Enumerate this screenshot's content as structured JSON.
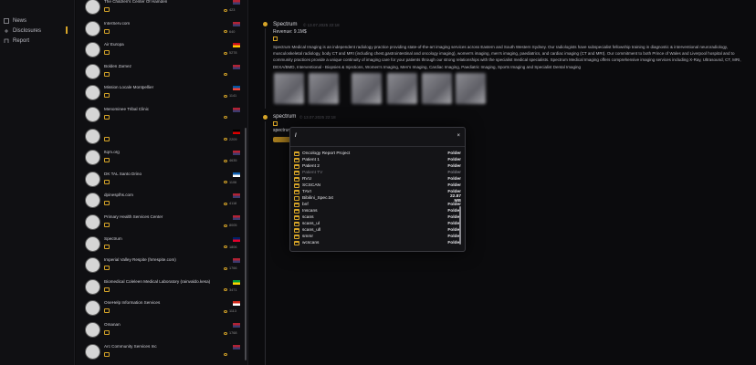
{
  "nav": {
    "items": [
      {
        "label": "News",
        "icon": "news-icon"
      },
      {
        "label": "Disclosures",
        "icon": "disclosures-icon"
      },
      {
        "label": "Report",
        "icon": "report-icon"
      }
    ]
  },
  "list": {
    "items": [
      {
        "name": "The Children's Center Of Hamden",
        "views": "423",
        "flag": "us"
      },
      {
        "name": "InterServ.com",
        "views": "640",
        "flag": "us"
      },
      {
        "name": "Air Europa",
        "views": "5278",
        "flag": "es"
      },
      {
        "name": "Bolden Zarnez",
        "views": "",
        "flag": "us"
      },
      {
        "name": "Mission Locale Montpellier",
        "views": "1141",
        "flag": "fr"
      },
      {
        "name": "Menominee Tribal Clinic",
        "views": "",
        "flag": "us"
      },
      {
        "name": "",
        "views": "2209",
        "flag": "de"
      },
      {
        "name": "Itqm.org",
        "views": "4635",
        "flag": "us"
      },
      {
        "name": "DK TAL Santo Drino",
        "views": "1106",
        "flag": "gr"
      },
      {
        "name": "dpinesplhs.com",
        "views": "4118",
        "flag": "us"
      },
      {
        "name": "Primary Health Services Center",
        "views": "8005",
        "flag": "us"
      },
      {
        "name": "Spectrum",
        "views": "1806",
        "flag": "au"
      },
      {
        "name": "Imperial Valley Respite (hrrespite.com)",
        "views": "1766",
        "flag": "us"
      },
      {
        "name": "Biomedical Coleleen Medical Laboratory (rainvaldo.kesa)",
        "views": "3471",
        "flag": "jm"
      },
      {
        "name": "OneHelp Information Services",
        "views": "1113",
        "flag": "ca"
      },
      {
        "name": "Omanan",
        "views": "1768",
        "flag": "us"
      },
      {
        "name": "Arc Community Services Inc",
        "views": "",
        "flag": "us"
      }
    ]
  },
  "detail": {
    "post1": {
      "title": "Spectrum",
      "meta": "© 13.07.2025 22:18",
      "revenue": "Revenue: 9.1M$",
      "description": "Spectrum Medical Imaging is an independent radiology practice providing state-of-the-art imaging services across Eastern and South Western Sydney. Our radiologists have subspecialist fellowship training in diagnostic & interventional neuroradiology, musculoskeletal radiology, body CT and MRI (including chest,gastrointestinal and oncology imaging), women's imaging, men's imaging, paediatrics, and cardiac imaging (CT and MRI). Our commitment to both Prince of Wales and Liverpool hospital and to community practices provide a unique continuity of imaging care for your patients through our strong relationships with the specialist medical specialists. Spectrum Medical Imaging offers comprehensive imaging services including X-Ray, Ultrasound, CT, MRI, DEXA/BMD, Interventional - Biopsies & Injections, Women's Imaging, Men's Imaging, Cardiac Imaging, Paediatric Imaging, Sports Imaging and Specialist Dental Imaging"
    },
    "post2": {
      "title": "spectrum",
      "meta": "© 13.07.2025 22:18",
      "sub": "spectrum"
    }
  },
  "modal": {
    "path": "/",
    "close": "×",
    "rows": [
      {
        "name": "Oncology Report Project",
        "type": "Folder",
        "kind": "folder"
      },
      {
        "name": "Patient 1",
        "type": "Folder",
        "kind": "folder"
      },
      {
        "name": "Patient 2",
        "type": "Folder",
        "kind": "folder"
      },
      {
        "name": "Patient TV",
        "type": "Folder",
        "kind": "folder",
        "dim": true
      },
      {
        "name": "RVU",
        "type": "Folder",
        "kind": "folder"
      },
      {
        "name": "SCSCAN",
        "type": "Folder",
        "kind": "folder"
      },
      {
        "name": "TAVI",
        "type": "Folder",
        "kind": "folder"
      },
      {
        "name": "Bibilini_Spec.txt",
        "type": "22.87 MB",
        "kind": "file"
      },
      {
        "name": "bnf",
        "type": "Folder",
        "kind": "folder"
      },
      {
        "name": "Inscans",
        "type": "Folder",
        "kind": "folder"
      },
      {
        "name": "scans",
        "type": "Folder",
        "kind": "folder"
      },
      {
        "name": "scans_ul",
        "type": "Folder",
        "kind": "folder"
      },
      {
        "name": "scans_ull",
        "type": "Folder",
        "kind": "folder"
      },
      {
        "name": "smmr",
        "type": "Folder",
        "kind": "folder"
      },
      {
        "name": "wcscans",
        "type": "Folder",
        "kind": "folder"
      }
    ]
  },
  "colors": {
    "accent": "#d7a528",
    "bg": "#0b0b0d"
  }
}
